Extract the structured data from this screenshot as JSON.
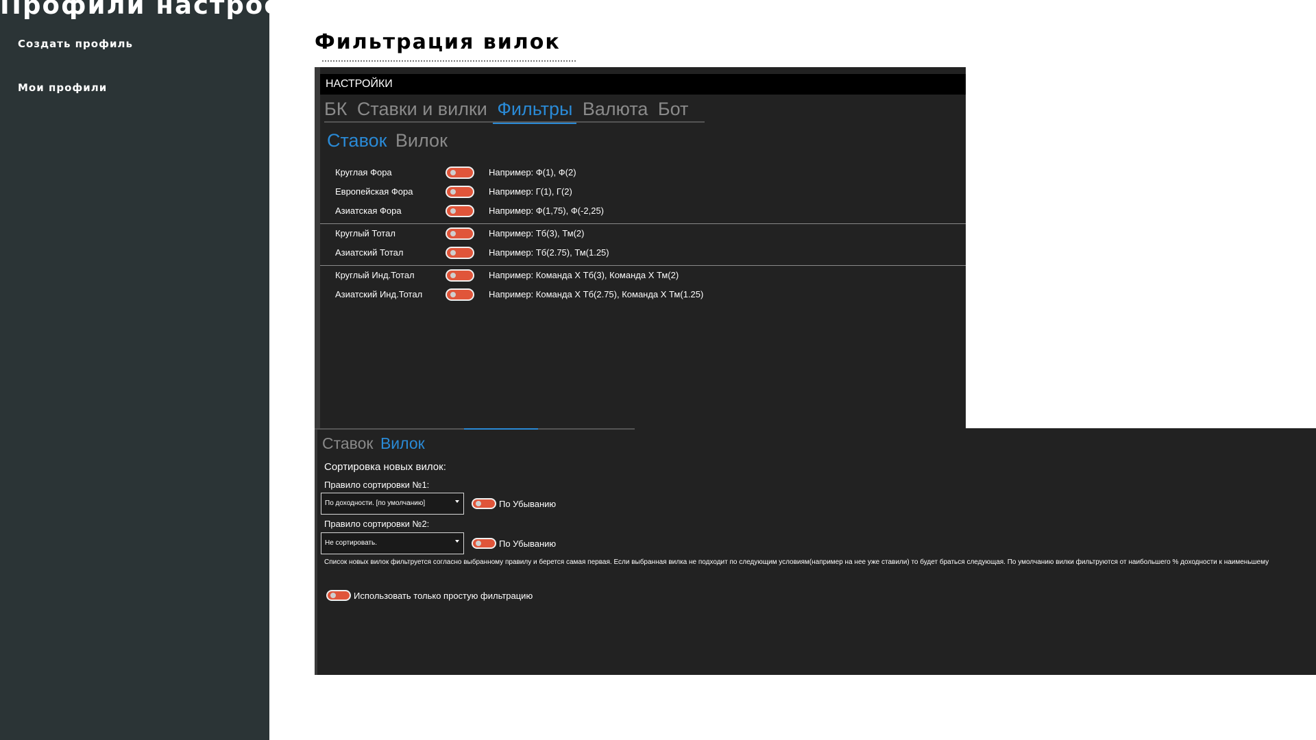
{
  "sidebar": {
    "title": "Профили настроек",
    "links": [
      "Создать профиль",
      "Мои профили"
    ]
  },
  "main": {
    "heading": "Фильтрация вилок"
  },
  "shot1": {
    "bar_title": "НАСТРОЙКИ",
    "tabs": [
      "БК",
      "Ставки и вилки",
      "Фильтры",
      "Валюта",
      "Бот"
    ],
    "active_tab": "Фильтры",
    "subtabs": [
      "Ставок",
      "Вилок"
    ],
    "active_subtab": "Ставок",
    "filters": [
      {
        "label": "Круглая Фора",
        "example": "Например: Ф(1), Ф(2)"
      },
      {
        "label": "Европейская Фора",
        "example": "Например: Г(1), Г(2)"
      },
      {
        "label": "Азиатская Фора",
        "example": "Например: Ф(1,75), Ф(-2,25)"
      },
      {
        "label": "Круглый Тотал",
        "example": "Например: Тб(3), Тм(2)"
      },
      {
        "label": "Азиатский Тотал",
        "example": "Например: Тб(2.75), Тм(1.25)"
      },
      {
        "label": "Круглый Инд.Тотал",
        "example": "Например: Команда Х Тб(3), Команда Х Тм(2)"
      },
      {
        "label": "Азиатский Инд.Тотал",
        "example": "Например: Команда Х Тб(2.75), Команда Х Тм(1.25)"
      }
    ]
  },
  "shot2": {
    "subtabs": [
      "Ставок",
      "Вилок"
    ],
    "active_subtab": "Вилок",
    "sort_heading": "Сортировка новых вилок:",
    "rule1_label": "Правило сортировки №1:",
    "rule1_value": "По доходности. [по умолчанию]",
    "rule1_toggle_label": "По Убыванию",
    "rule2_label": "Правило сортировки №2:",
    "rule2_value": "Не сортировать.",
    "rule2_toggle_label": "По Убыванию",
    "description": "Список новых вилок фильтруется согласно выбранному правилу и берется самая первая. Если выбранная вилка не подходит по следующим условиям(например на нее уже ставили) то будет браться следующая. По умолчанию вилки фильтруются от наибольшего % доходности к наименьшему",
    "simple_filter_label": "Использовать только простую фильтрацию"
  },
  "colors": {
    "sidebar_bg": "#2b3436",
    "panel_bg": "#222222",
    "accent_blue": "#2a8ad6",
    "toggle_off": "#e0553a"
  }
}
